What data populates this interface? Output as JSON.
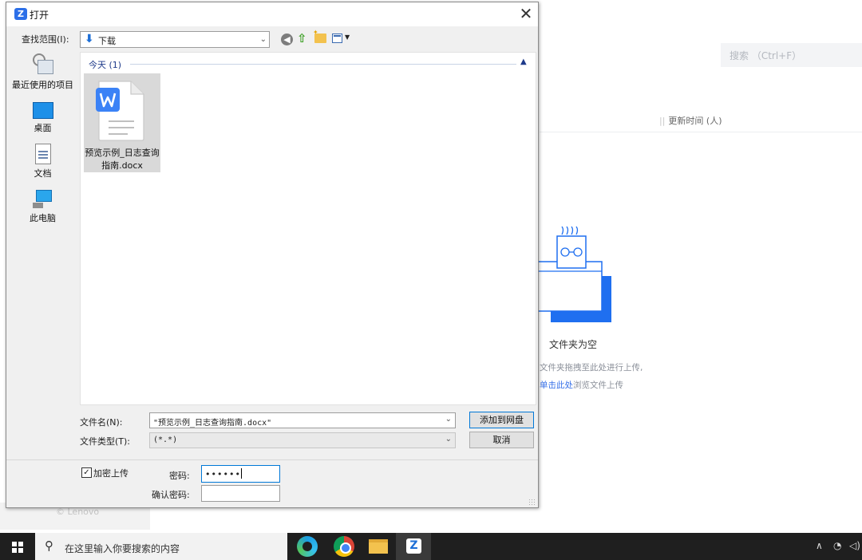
{
  "background_app": {
    "search_placeholder": "搜索  （Ctrl+F）",
    "column_header": "更新时间 (人)",
    "empty_title": "文件夹为空",
    "empty_hint": "文件夹拖拽至此处进行上传,",
    "empty_link": "单击此处",
    "empty_link_rest": "浏览文件上传",
    "watermark": "© Lenovo"
  },
  "dialog": {
    "app_icon": "Z",
    "title": "打开",
    "close_glyph": "✕",
    "look_in_label": "查找范围(I):",
    "look_in_value": "下载",
    "places": [
      {
        "label": "最近使用的项目",
        "icon": "recent-icon"
      },
      {
        "label": "桌面",
        "icon": "desktop-icon"
      },
      {
        "label": "文档",
        "icon": "documents-icon"
      },
      {
        "label": "此电脑",
        "icon": "this-pc-icon"
      }
    ],
    "group_header": "今天 (1)",
    "files": [
      {
        "name_line1": "预览示例_日志查询",
        "name_line2": "指南.docx",
        "icon": "word-doc-icon"
      }
    ],
    "file_name_label": "文件名(N):",
    "file_name_value": "\"预览示例_日志查询指南.docx\"",
    "file_type_label": "文件类型(T):",
    "file_type_value": "(*.*)",
    "primary_button": "添加到网盘",
    "cancel_button": "取消",
    "encrypt_label": "加密上传",
    "encrypt_checked": true,
    "password_label": "密码:",
    "password_value": "••••••",
    "confirm_password_label": "确认密码:",
    "confirm_password_value": ""
  },
  "taskbar": {
    "search_placeholder": "在这里输入你要搜索的内容",
    "apps": [
      "edge-icon",
      "chrome-icon",
      "file-explorer-icon",
      "zapp-icon"
    ],
    "active_app_letter": "Z"
  },
  "colors": {
    "accent": "#0078d7",
    "brand_blue": "#1e6fd6",
    "word_blue": "#3b82f6",
    "taskbar": "#1f1f1f"
  }
}
